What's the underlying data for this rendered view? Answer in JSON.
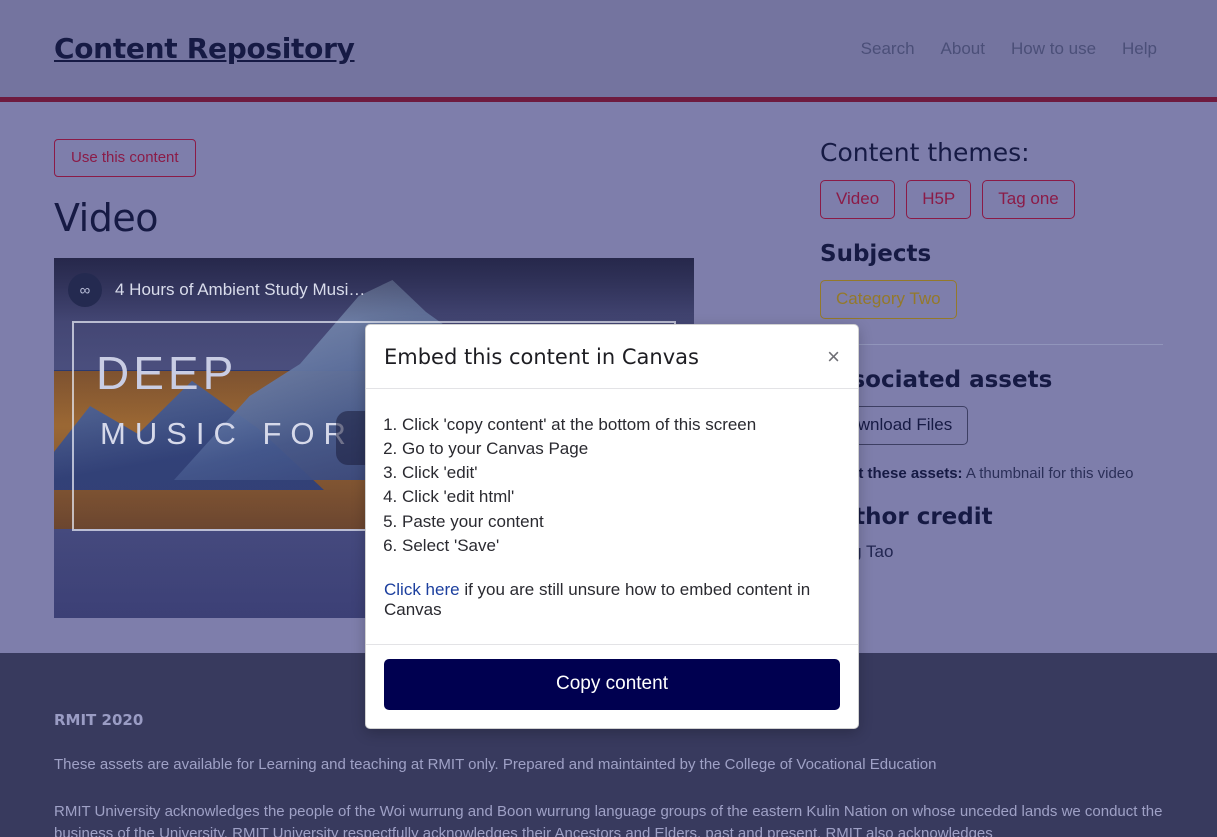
{
  "header": {
    "brand": "Content Repository",
    "nav": [
      {
        "label": "Search"
      },
      {
        "label": "About"
      },
      {
        "label": "How to use"
      },
      {
        "label": "Help"
      }
    ]
  },
  "main": {
    "use_content_label": "Use this content",
    "page_title": "Video",
    "video": {
      "channel_icon": "infinity-logo-icon",
      "overlay_title": "4 Hours of Ambient Study Musi…",
      "poster_line1": "DEEP",
      "poster_line2": "MUSIC FOR"
    }
  },
  "sidebar": {
    "themes_heading": "Content themes:",
    "themes": [
      {
        "label": "Video"
      },
      {
        "label": "H5P"
      },
      {
        "label": "Tag one"
      }
    ],
    "subjects_heading": "Subjects",
    "subjects": [
      {
        "label": "Category Two"
      }
    ],
    "assets_heading": "Associated assets",
    "download_label": "Download Files",
    "assets_note_label": "About these assets:",
    "assets_note_value": "A thumbnail for this video",
    "credit_heading": "Author credit",
    "credit_name": "Liang Tao"
  },
  "modal": {
    "title": "Embed this content in Canvas",
    "close_icon": "×",
    "steps": [
      "Click 'copy content' at the bottom of this screen",
      "Go to your Canvas Page",
      "Click 'edit'",
      "Click 'edit html'",
      "Paste your content",
      "Select 'Save'"
    ],
    "help_link": "Click here",
    "help_rest": " if you are still unsure how to embed content in Canvas",
    "copy_label": "Copy content"
  },
  "footer": {
    "brand": "RMIT 2020",
    "line1": "These assets are available for Learning and teaching at RMIT only. Prepared and maintainted by the College of Vocational Education",
    "line2": "RMIT University acknowledges the people of the Woi wurrung and Boon wurrung language groups of the eastern Kulin Nation on whose unceded lands we conduct the business of the University. RMIT University respectfully acknowledges their Ancestors and Elders, past and present. RMIT also acknowledges"
  },
  "colors": {
    "page_bg": "#7e7eab",
    "header_bg": "#74749f",
    "header_rule": "#6e1b3f",
    "accent_maroon": "#8b1b47",
    "accent_olive": "#94792a",
    "navy_button": "#000050",
    "footer_bg": "#383a5e"
  }
}
